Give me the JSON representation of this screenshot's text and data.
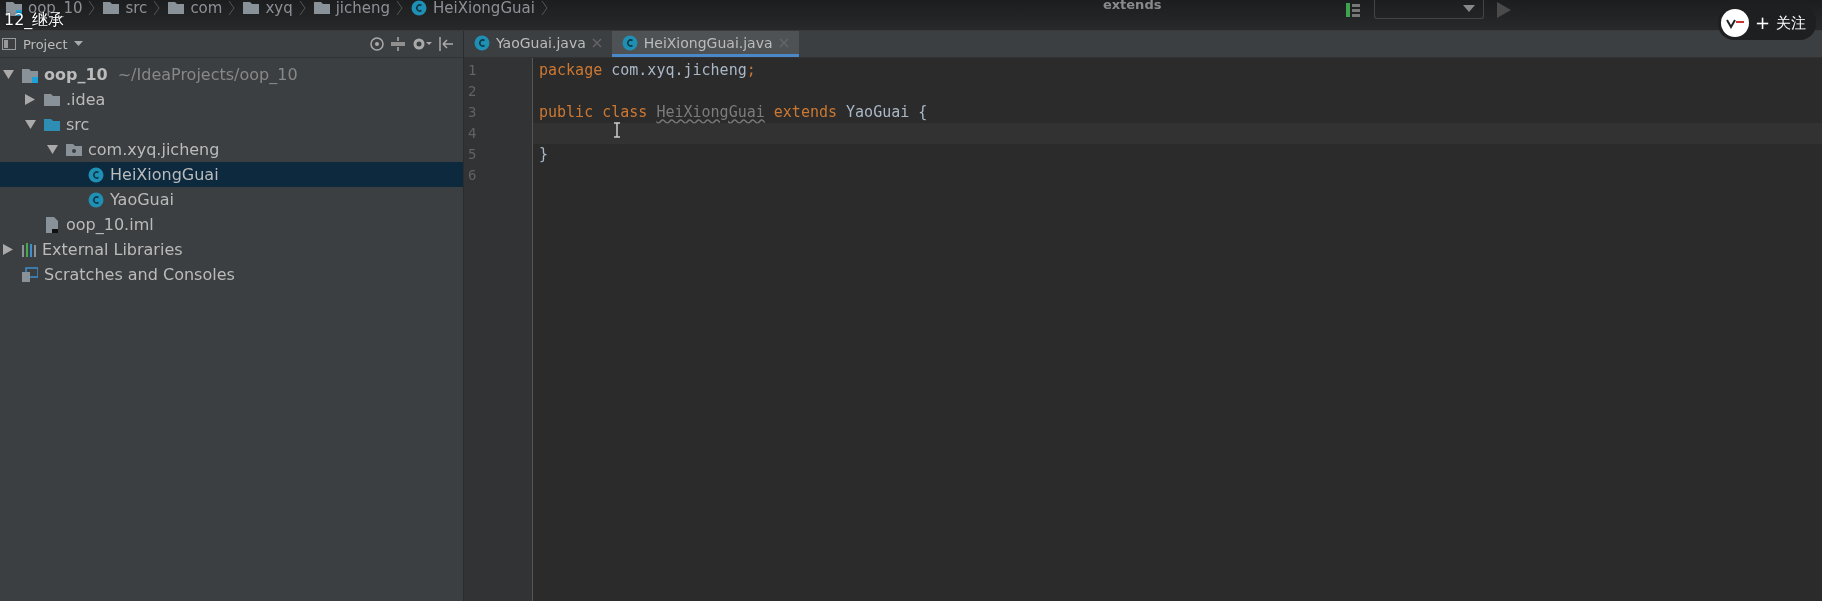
{
  "video_title": "12_继承",
  "breadcrumbs": [
    {
      "label": "oop_10",
      "kind": "module"
    },
    {
      "label": "src",
      "kind": "folder"
    },
    {
      "label": "com",
      "kind": "folder"
    },
    {
      "label": "xyq",
      "kind": "folder"
    },
    {
      "label": "jicheng",
      "kind": "folder"
    },
    {
      "label": "HeiXiongGuai",
      "kind": "class"
    }
  ],
  "center_label": "extends",
  "follow_button": {
    "plus": "+",
    "label": "关注"
  },
  "project_panel": {
    "title": "Project",
    "tree": [
      {
        "label": "oop_10",
        "note": "~/IdeaProjects/oop_10",
        "kind": "module",
        "expanded": true,
        "selected": false,
        "children": [
          {
            "label": ".idea",
            "kind": "folder",
            "expanded": false,
            "selected": false
          },
          {
            "label": "src",
            "kind": "source",
            "expanded": true,
            "selected": false,
            "children": [
              {
                "label": "com.xyq.jicheng",
                "kind": "package",
                "expanded": true,
                "selected": false,
                "children": [
                  {
                    "label": "HeiXiongGuai",
                    "kind": "class",
                    "selected": true
                  },
                  {
                    "label": "YaoGuai",
                    "kind": "class",
                    "selected": false
                  }
                ]
              }
            ]
          },
          {
            "label": "oop_10.iml",
            "kind": "file",
            "selected": false
          }
        ]
      },
      {
        "label": "External Libraries",
        "kind": "libraries",
        "expanded": false,
        "selected": false
      },
      {
        "label": "Scratches and Consoles",
        "kind": "scratches",
        "selected": false
      }
    ]
  },
  "tabs": [
    {
      "label": "YaoGuai.java",
      "selected": false
    },
    {
      "label": "HeiXiongGuai.java",
      "selected": true
    }
  ],
  "editor": {
    "lines": [
      {
        "number": "1",
        "tokens": [
          {
            "text": "package",
            "kind": "keyword"
          },
          {
            "text": " com.xyq.jicheng",
            "kind": "plain"
          },
          {
            "text": ";",
            "kind": "keyword"
          }
        ]
      },
      {
        "number": "2"
      },
      {
        "number": "3",
        "tokens": [
          {
            "text": "public class ",
            "kind": "keyword"
          },
          {
            "text": "HeiXiongGuai",
            "kind": "unused"
          },
          {
            "text": " extends ",
            "kind": "keyword"
          },
          {
            "text": "YaoGuai {",
            "kind": "plain"
          }
        ]
      },
      {
        "number": "4",
        "current": true
      },
      {
        "number": "5",
        "tokens": [
          {
            "text": "}",
            "kind": "plain"
          }
        ]
      },
      {
        "number": "6"
      }
    ]
  }
}
